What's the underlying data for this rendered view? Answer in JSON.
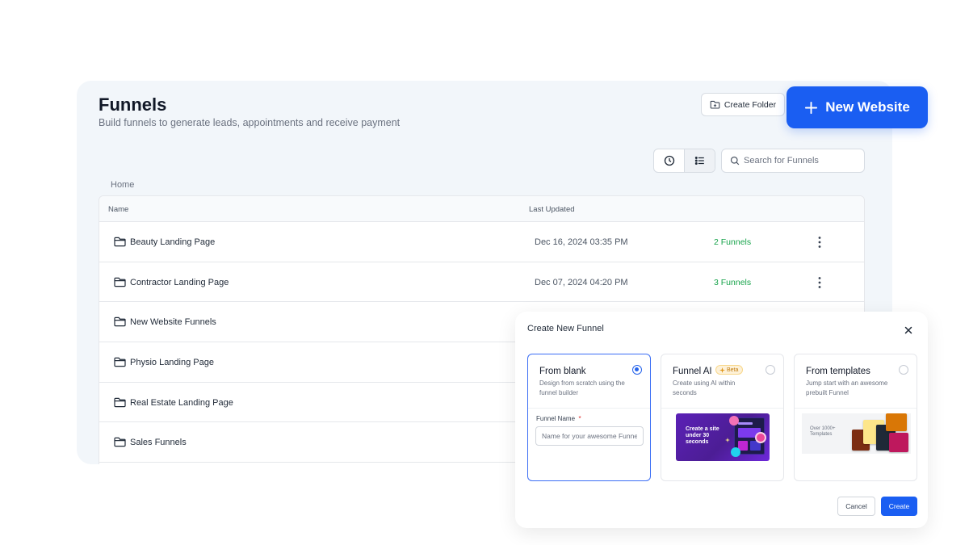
{
  "header": {
    "title": "Funnels",
    "subtitle": "Build funnels to generate leads, appointments and receive payment",
    "create_folder_label": "Create Folder",
    "new_website_label": "New Website"
  },
  "toolbar": {
    "search_placeholder": "Search for Funnels",
    "view_modes": [
      "clock-icon",
      "list-icon"
    ],
    "active_view": "list"
  },
  "breadcrumb": "Home",
  "table": {
    "columns": [
      "Name",
      "Last Updated"
    ],
    "rows": [
      {
        "name": "Beauty Landing Page",
        "updated": "Dec 16, 2024 03:35 PM",
        "count": "2 Funnels"
      },
      {
        "name": "Contractor Landing Page",
        "updated": "Dec 07, 2024 04:20 PM",
        "count": "3 Funnels"
      },
      {
        "name": "New Website Funnels",
        "updated": "",
        "count": ""
      },
      {
        "name": "Physio Landing Page",
        "updated": "",
        "count": ""
      },
      {
        "name": "Real Estate Landing Page",
        "updated": "",
        "count": ""
      },
      {
        "name": "Sales Funnels",
        "updated": "",
        "count": ""
      }
    ]
  },
  "modal": {
    "title": "Create New Funnel",
    "options": [
      {
        "title": "From blank",
        "description": "Design from scratch using the funnel builder",
        "selected": true
      },
      {
        "title": "Funnel AI",
        "badge": "Beta",
        "description": "Create using AI within seconds",
        "thumb_text": "Create a site under 30 seconds"
      },
      {
        "title": "From templates",
        "description": "Jump start with an awesome prebuilt Funnel",
        "thumb_text": "Over 1000+ Templates"
      }
    ],
    "funnel_name_label": "Funnel Name",
    "required_mark": "*",
    "funnel_name_placeholder": "Name for your awesome Funnel",
    "cancel_label": "Cancel",
    "create_label": "Create"
  },
  "colors": {
    "primary": "#1a5ef2",
    "success": "#16a34a",
    "panel_bg": "#f2f6fa"
  }
}
